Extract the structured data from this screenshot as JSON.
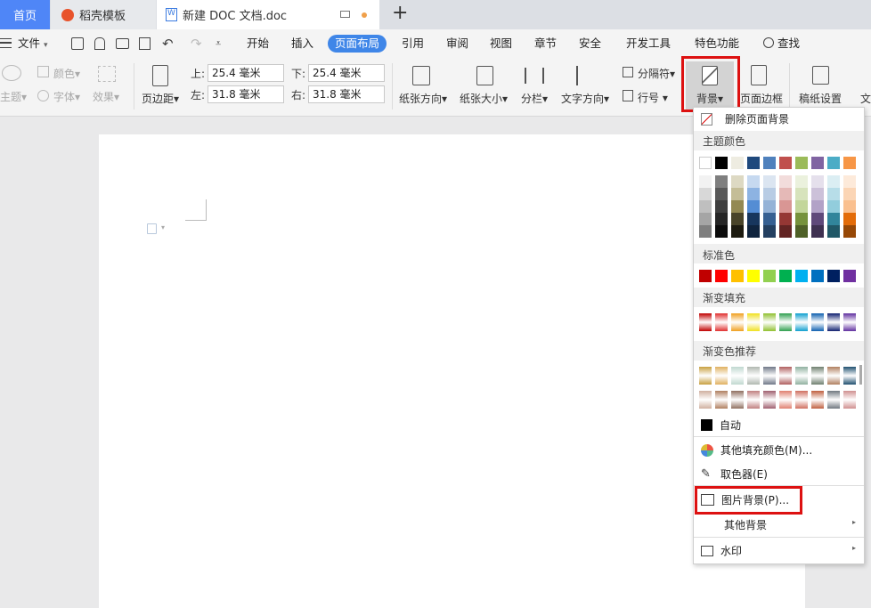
{
  "tabs": {
    "home": "首页",
    "template": "稻壳模板",
    "doc": "新建 DOC 文档.doc",
    "add": "+"
  },
  "menu": {
    "file": "文件",
    "items": [
      "开始",
      "插入",
      "页面布局",
      "引用",
      "审阅",
      "视图",
      "章节",
      "安全",
      "开发工具",
      "特色功能"
    ],
    "search": "查找"
  },
  "ribbon": {
    "theme": "主题",
    "color": "颜色",
    "font": "字体",
    "effect": "效果",
    "margins": "页边距",
    "top_label": "上:",
    "top_value": "25.4 毫米",
    "bottom_label": "下:",
    "bottom_value": "25.4 毫米",
    "left_label": "左:",
    "left_value": "31.8 毫米",
    "right_label": "右:",
    "right_value": "31.8 毫米",
    "orientation": "纸张方向",
    "size": "纸张大小",
    "columns": "分栏",
    "text_direction": "文字方向",
    "separator": "分隔符",
    "line_number": "行号",
    "background": "背景",
    "page_border": "页面边框",
    "paper_settings": "稿纸设置",
    "more": "文"
  },
  "dropdown": {
    "remove": "删除页面背景",
    "theme_colors": "主题颜色",
    "standard": "标准色",
    "gradient": "渐变填充",
    "gradient_rec": "渐变色推荐",
    "auto": "自动",
    "more_fill": "其他填充颜色(M)...",
    "eyedropper": "取色器(E)",
    "picture_bg": "图片背景(P)...",
    "other_bg": "其他背景",
    "watermark": "水印"
  },
  "colors": {
    "theme_top": [
      "#ffffff",
      "#000000",
      "#eeece1",
      "#1f497d",
      "#4f81bd",
      "#c0504d",
      "#9bbb59",
      "#8064a2",
      "#4bacc6",
      "#f79646"
    ],
    "theme_shades": [
      [
        "#f2f2f2",
        "#7f7f7f",
        "#ddd9c3",
        "#c6d9f0",
        "#dbe5f1",
        "#f2dcdb",
        "#ebf1dd",
        "#e5e0ec",
        "#dbeef3",
        "#fdeada"
      ],
      [
        "#d8d8d8",
        "#595959",
        "#c4bd97",
        "#8db3e2",
        "#b8cce4",
        "#e5b9b7",
        "#d7e3bc",
        "#ccc1d9",
        "#b7dde8",
        "#fbd5b5"
      ],
      [
        "#bfbfbf",
        "#3f3f3f",
        "#938953",
        "#548dd4",
        "#95b3d7",
        "#d99694",
        "#c3d69b",
        "#b2a2c7",
        "#92cddc",
        "#fac08f"
      ],
      [
        "#a5a5a5",
        "#262626",
        "#494429",
        "#17365d",
        "#366092",
        "#953734",
        "#76923c",
        "#5f497a",
        "#31859b",
        "#e36c09"
      ],
      [
        "#7f7f7f",
        "#0c0c0c",
        "#1d1b10",
        "#0f243e",
        "#244061",
        "#632423",
        "#4f6128",
        "#3f3151",
        "#205867",
        "#974806"
      ]
    ],
    "standard": [
      "#c00000",
      "#ff0000",
      "#ffc000",
      "#ffff00",
      "#92d050",
      "#00b050",
      "#00b0f0",
      "#0070c0",
      "#002060",
      "#7030a0"
    ],
    "gradient": [
      "#c00000",
      "#e03030",
      "#f0a020",
      "#f0e020",
      "#90c030",
      "#30a050",
      "#10a0d0",
      "#1060b0",
      "#102070",
      "#6030a0"
    ],
    "grad_rec_1": [
      "#c8a040",
      "#e0b060",
      "#c0d8d0",
      "#b0b8b0",
      "#707888",
      "#b06060",
      "#90b0a0",
      "#708070",
      "#b08060",
      "#205070"
    ],
    "grad_rec_2": [
      "#d0b0a0",
      "#b08060",
      "#907060",
      "#c08080",
      "#a06070",
      "#e08070",
      "#d07060",
      "#c06040",
      "#707880",
      "#d09090"
    ]
  }
}
